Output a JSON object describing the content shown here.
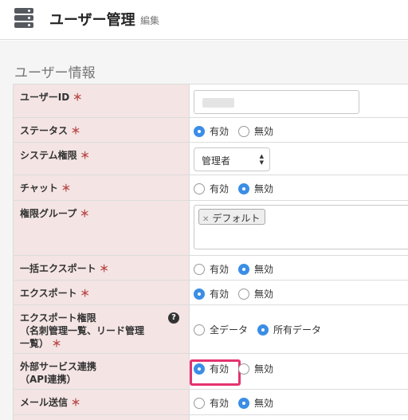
{
  "header": {
    "title": "ユーザー管理",
    "subtitle": "編集",
    "icon": "database-icon"
  },
  "section": {
    "title": "ユーザー情報"
  },
  "required_mark": "＊",
  "colors": {
    "label_bg": "#f4e4e4",
    "required": "#b94a48",
    "radio_on": "#3b8ee6",
    "highlight": "#e5336e"
  },
  "rows": [
    {
      "label": "ユーザーID",
      "type": "text"
    },
    {
      "label": "ステータス",
      "type": "radio",
      "options": [
        "有効",
        "無効"
      ],
      "selected": "有効"
    },
    {
      "label": "システム権限",
      "type": "select",
      "value": "管理者"
    },
    {
      "label": "チャット",
      "type": "radio",
      "options": [
        "有効",
        "無効"
      ],
      "selected": "無効"
    },
    {
      "label": "権限グループ",
      "type": "tags",
      "tags": [
        "デフォルト"
      ]
    },
    {
      "label": "一括エクスポート",
      "type": "radio",
      "options": [
        "有効",
        "無効"
      ],
      "selected": "無効"
    },
    {
      "label": "エクスポート",
      "type": "radio",
      "options": [
        "有効",
        "無効"
      ],
      "selected": "有効"
    },
    {
      "label_lines": [
        "エクスポート権限",
        "（名刺管理一覧、リード管理",
        "一覧）"
      ],
      "type": "radio",
      "options": [
        "全データ",
        "所有データ"
      ],
      "selected": "所有データ",
      "help_icon": "?"
    },
    {
      "label_lines": [
        "外部サービス連携",
        "（API連携）"
      ],
      "type": "radio",
      "options": [
        "有効",
        "無効"
      ],
      "selected": "有効",
      "highlighted_option": "有効"
    },
    {
      "label": "メール送信",
      "type": "radio",
      "options": [
        "有効",
        "無効"
      ],
      "selected": "無効"
    }
  ]
}
